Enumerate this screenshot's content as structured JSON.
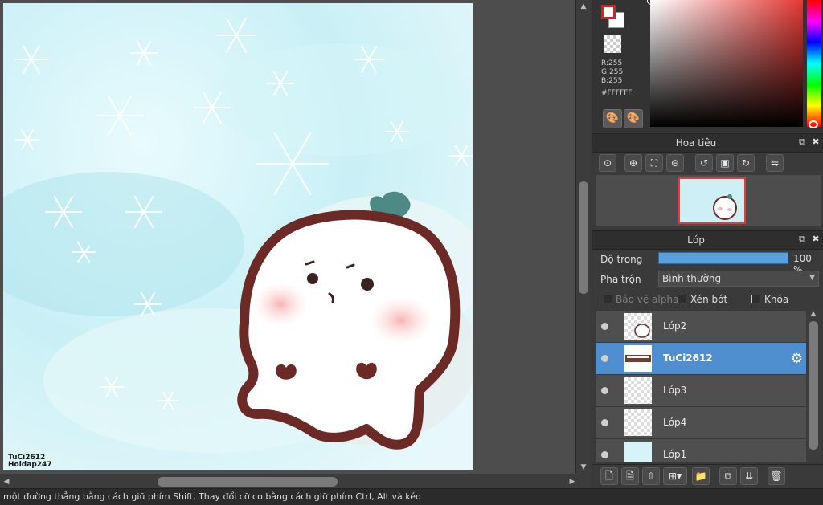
{
  "canvas": {
    "signature_line1": "TuCi2612",
    "signature_line2": "Holdap247"
  },
  "status_bar": {
    "text": "một đường thẳng bằng cách giữ phím Shift, Thay đổi cỡ cọ bằng cách giữ phím Ctrl, Alt và kéo"
  },
  "color_panel": {
    "r": "R:255",
    "g": "G:255",
    "b": "B:255",
    "hex": "#FFFFFF",
    "foreground": "#FFFFFF",
    "accent": "#C62828"
  },
  "navigator": {
    "title": "Hoa tiêu"
  },
  "layers": {
    "title": "Lớp",
    "opacity_label": "Độ trong",
    "opacity_value": "100 %",
    "opacity_fraction": 1.0,
    "blend_label": "Pha trộn",
    "blend_value": "Bình thường",
    "protect_alpha_label": "Bảo vệ alpha",
    "clipping_label": "Xén bớt",
    "lock_label": "Khóa",
    "items": [
      {
        "name": "Lớp2",
        "selected": false
      },
      {
        "name": "TuCi2612",
        "selected": true
      },
      {
        "name": "Lớp3",
        "selected": false
      },
      {
        "name": "Lớp4",
        "selected": false
      },
      {
        "name": "Lớp1",
        "selected": false
      }
    ]
  },
  "icons": {
    "popout": "popout-icon",
    "close": "close-icon",
    "gear": "gear-icon"
  }
}
